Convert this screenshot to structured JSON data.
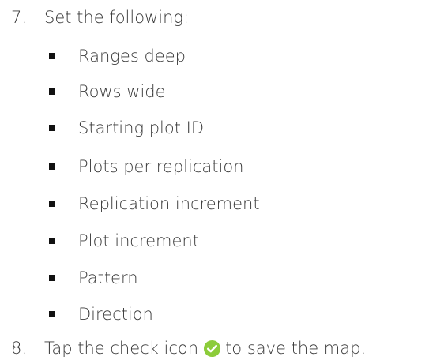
{
  "steps": [
    {
      "number": "7.",
      "text": "Set the following:",
      "items": [
        "Ranges deep",
        "Rows wide",
        "Starting plot ID",
        "Plots per replication",
        "Replication increment",
        "Plot increment",
        "Pattern",
        "Direction"
      ]
    },
    {
      "number": "8.",
      "text_before_icon": "Tap the check icon",
      "icon": "check-circle-icon",
      "text_after_icon": "to save the map."
    }
  ],
  "colors": {
    "text": "#3a3a3a",
    "bullet": "#111111",
    "check_fill": "#8ccc3a",
    "check_mark": "#ffffff"
  }
}
